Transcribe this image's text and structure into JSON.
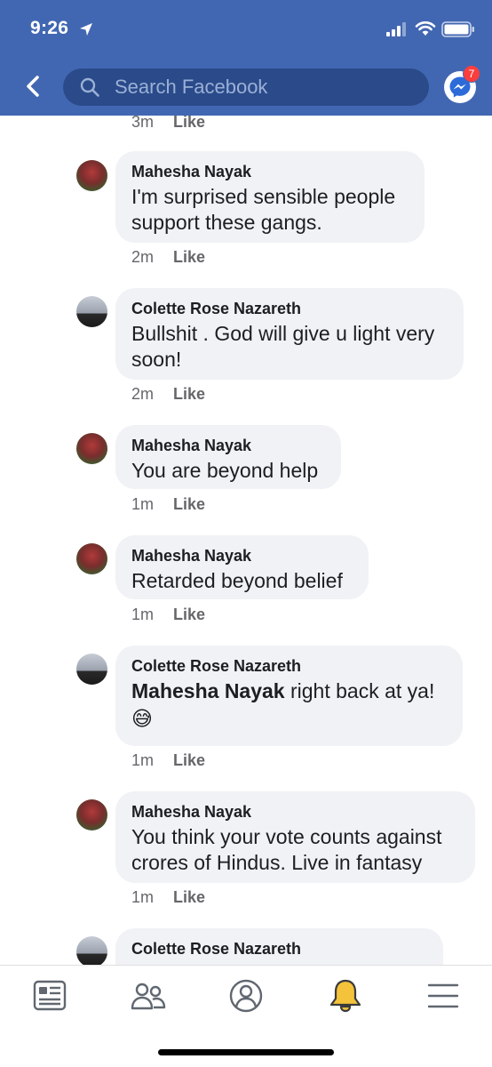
{
  "status_bar": {
    "time": "9:26"
  },
  "header": {
    "search_placeholder": "Search Facebook",
    "messenger_badge": "7"
  },
  "partial_top": {
    "time": "3m",
    "like": "Like"
  },
  "comments": [
    {
      "author": "Mahesha Nayak",
      "text": "I'm surprised sensible people support these gangs.",
      "time": "2m",
      "like": "Like"
    },
    {
      "author": "Colette Rose Nazareth",
      "text": "Bullshit . God will give u light very soon!",
      "time": "2m",
      "like": "Like"
    },
    {
      "author": "Mahesha Nayak",
      "text": "You are beyond help",
      "time": "1m",
      "like": "Like"
    },
    {
      "author": "Mahesha Nayak",
      "text": "Retarded beyond belief",
      "time": "1m",
      "like": "Like"
    },
    {
      "author": "Colette Rose Nazareth",
      "mention": "Mahesha Nayak",
      "text": " right back at ya!",
      "emoji": "😅",
      "time": "1m",
      "like": "Like"
    },
    {
      "author": "Mahesha Nayak",
      "text": "You think your vote counts against crores of Hindus. Live in fantasy",
      "time": "1m",
      "like": "Like"
    },
    {
      "author": "Colette Rose Nazareth"
    }
  ],
  "tabbar": {
    "icons": [
      "news-feed-icon",
      "friends-icon",
      "profile-icon",
      "notifications-bell-icon",
      "menu-icon"
    ],
    "active_color": "#f5c33b"
  },
  "colors": {
    "brand": "#4267b2",
    "bubble": "#f0f2f5",
    "meta": "#65676b"
  }
}
